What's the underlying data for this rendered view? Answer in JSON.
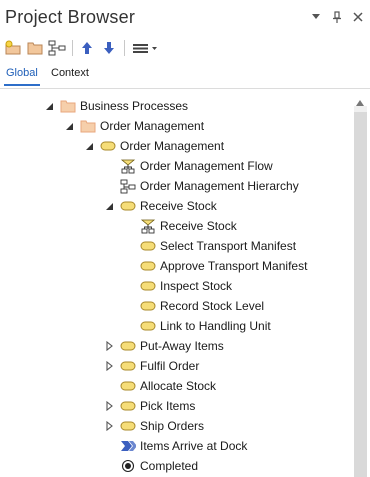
{
  "window": {
    "title": "Project Browser"
  },
  "title_buttons": [
    {
      "name": "dropdown-arrow-icon"
    },
    {
      "name": "pin-icon"
    },
    {
      "name": "close-icon"
    }
  ],
  "toolbar": {
    "buttons": [
      {
        "name": "new-package-icon"
      },
      {
        "name": "new-folder-icon"
      },
      {
        "name": "new-diagram-icon"
      },
      {
        "name": "move-up-icon"
      },
      {
        "name": "move-down-icon"
      },
      {
        "name": "menu-icon"
      }
    ]
  },
  "tabs": [
    {
      "label": "Global",
      "active": true
    },
    {
      "label": "Context",
      "active": false
    }
  ],
  "tree": [
    {
      "label": "Business Processes",
      "icon": "folder",
      "expander": "expanded",
      "level": 0
    },
    {
      "label": "Order Management",
      "icon": "folder",
      "expander": "expanded",
      "level": 1
    },
    {
      "label": "Order Management",
      "icon": "activity",
      "expander": "expanded",
      "level": 2
    },
    {
      "label": "Order Management Flow",
      "icon": "flow-diagram",
      "expander": "none",
      "level": 3
    },
    {
      "label": "Order Management Hierarchy",
      "icon": "hierarchy-diagram",
      "expander": "none",
      "level": 3
    },
    {
      "label": "Receive Stock",
      "icon": "activity",
      "expander": "expanded",
      "level": 3
    },
    {
      "label": "Receive Stock",
      "icon": "flow-diagram",
      "expander": "none",
      "level": 4
    },
    {
      "label": "Select Transport Manifest",
      "icon": "activity",
      "expander": "none",
      "level": 4
    },
    {
      "label": "Approve Transport Manifest",
      "icon": "activity",
      "expander": "none",
      "level": 4
    },
    {
      "label": "Inspect Stock",
      "icon": "activity",
      "expander": "none",
      "level": 4
    },
    {
      "label": "Record Stock Level",
      "icon": "activity",
      "expander": "none",
      "level": 4
    },
    {
      "label": "Link to Handling Unit",
      "icon": "activity",
      "expander": "none",
      "level": 4
    },
    {
      "label": "Put-Away Items",
      "icon": "activity",
      "expander": "collapsed",
      "level": 3
    },
    {
      "label": "Fulfil Order",
      "icon": "activity",
      "expander": "collapsed",
      "level": 3
    },
    {
      "label": "Allocate Stock",
      "icon": "activity",
      "expander": "none",
      "level": 3
    },
    {
      "label": "Pick Items",
      "icon": "activity",
      "expander": "collapsed",
      "level": 3
    },
    {
      "label": "Ship Orders",
      "icon": "activity",
      "expander": "collapsed",
      "level": 3
    },
    {
      "label": "Items Arrive at Dock",
      "icon": "event",
      "expander": "none",
      "level": 3
    },
    {
      "label": "Completed",
      "icon": "final",
      "expander": "none",
      "level": 3
    }
  ],
  "colors": {
    "accent": "#2d6ec9",
    "folder": "#e8a77e",
    "activity": "#e8c95a",
    "arrow_icon": "#3b5fbf"
  }
}
